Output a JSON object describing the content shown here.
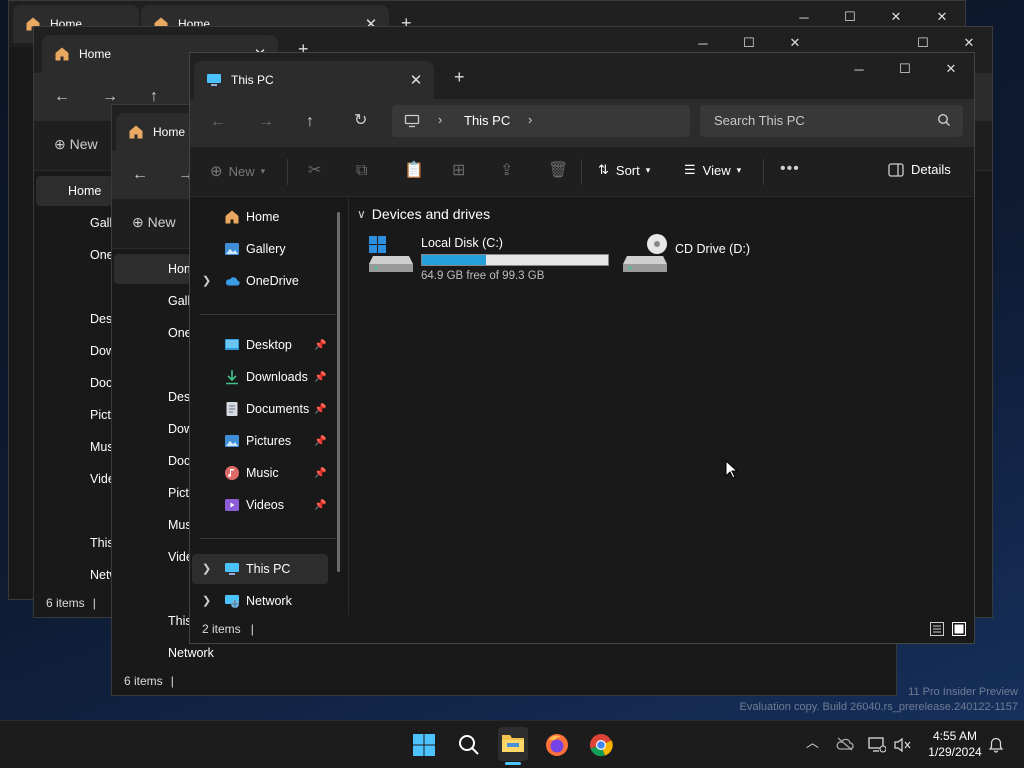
{
  "desktop": {
    "watermark_line1": "11 Pro Insider Preview",
    "watermark_line2": "Evaluation copy. Build 26040.rs_prerelease.240122-1157"
  },
  "back_windows": [
    {
      "tab1": "Home",
      "tab2": "Home"
    },
    {
      "tab": "Home",
      "status_count": "6 items",
      "items": [
        "Home",
        "Gallery",
        "OneDrive",
        "Desktop",
        "Downloads",
        "Documents",
        "Pictures",
        "Music",
        "Videos",
        "This PC",
        "Network"
      ]
    },
    {
      "tab": "Home",
      "status_count": "6 items",
      "items": [
        "Home",
        "Gallery",
        "OneDrive",
        "Desktop",
        "Downloads",
        "Documents",
        "Pictures",
        "Music",
        "Videos",
        "This PC",
        "Network"
      ]
    }
  ],
  "window": {
    "tab_title": "This PC",
    "address_item": "This PC",
    "search_placeholder": "Search This PC",
    "commands": {
      "new": "New",
      "sort": "Sort",
      "view": "View",
      "details": "Details"
    },
    "sidebar": {
      "top": [
        {
          "label": "Home",
          "icon": "home-icon"
        },
        {
          "label": "Gallery",
          "icon": "gallery-icon"
        },
        {
          "label": "OneDrive",
          "icon": "onedrive-icon"
        }
      ],
      "quick_access": [
        {
          "label": "Desktop",
          "icon": "desktop-icon"
        },
        {
          "label": "Downloads",
          "icon": "downloads-icon"
        },
        {
          "label": "Documents",
          "icon": "documents-icon"
        },
        {
          "label": "Pictures",
          "icon": "pictures-icon"
        },
        {
          "label": "Music",
          "icon": "music-icon"
        },
        {
          "label": "Videos",
          "icon": "videos-icon"
        }
      ],
      "bottom": [
        {
          "label": "This PC",
          "icon": "this-pc-icon",
          "selected": true
        },
        {
          "label": "Network",
          "icon": "network-icon"
        }
      ]
    },
    "content": {
      "group_title": "Devices and drives",
      "drives": [
        {
          "name": "Local Disk (C:)",
          "free_text": "64.9 GB free of 99.3 GB",
          "used_fraction": 0.346
        },
        {
          "name": "CD Drive (D:)"
        }
      ]
    },
    "status_count": "2 items"
  },
  "taskbar": {
    "clock_time": "4:55 AM",
    "clock_date": "1/29/2024"
  },
  "colors": {
    "accent": "#4cc2ff",
    "drive_bar_fill": "#26a0da",
    "drive_bar_track": "#e6e6e6",
    "window_bg": "#191919",
    "titlebar_bg": "#202020"
  }
}
